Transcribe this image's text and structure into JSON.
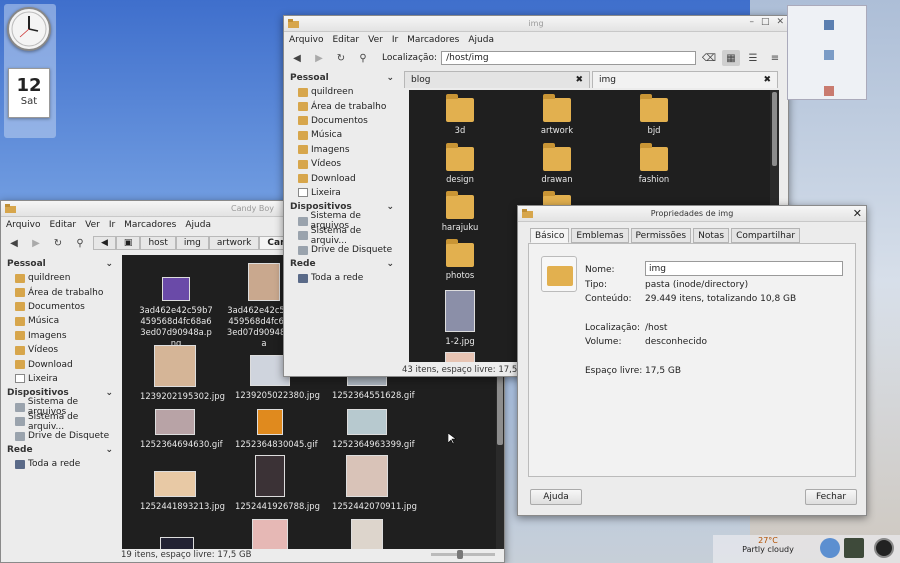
{
  "desktop": {
    "calendar": {
      "day_number": "12",
      "day_name": "Sat"
    }
  },
  "win_img": {
    "title": "img",
    "menu": [
      "Arquivo",
      "Editar",
      "Ver",
      "Ir",
      "Marcadores",
      "Ajuda"
    ],
    "location_label": "Localização:",
    "location_value": "/host/img",
    "sidebar": {
      "pessoal_header": "Pessoal",
      "pessoal": [
        "quildreen",
        "Área de trabalho",
        "Documentos",
        "Música",
        "Imagens",
        "Vídeos",
        "Download",
        "Lixeira"
      ],
      "dispositivos_header": "Dispositivos",
      "dispositivos": [
        "Sistema de arquivos",
        "Sistema de arquiv...",
        "Drive de Disquete"
      ],
      "rede_header": "Rede",
      "rede": [
        "Toda a rede"
      ]
    },
    "tabs": [
      {
        "label": "blog"
      },
      {
        "label": "img"
      }
    ],
    "files": [
      "3d",
      "artwork",
      "bjd",
      "design",
      "drawan",
      "fashion",
      "harajuku",
      "",
      "",
      "photos",
      "1-2.jpg"
    ],
    "status": "43 itens, espaço livre: 17,5 GB"
  },
  "win_candy": {
    "title": "Candy Boy",
    "menu": [
      "Arquivo",
      "Editar",
      "Ver",
      "Ir",
      "Marcadores",
      "Ajuda"
    ],
    "breadcrumb": [
      "host",
      "img",
      "artwork",
      "Cand"
    ],
    "sidebar": {
      "pessoal_header": "Pessoal",
      "pessoal": [
        "quildreen",
        "Área de trabalho",
        "Documentos",
        "Música",
        "Imagens",
        "Vídeos",
        "Download",
        "Lixeira"
      ],
      "dispositivos_header": "Dispositivos",
      "dispositivos": [
        "Sistema de arquivos",
        "Sistema de arquiv...",
        "Drive de Disquete"
      ],
      "rede_header": "Rede",
      "rede": [
        "Toda a rede"
      ]
    },
    "files": [
      "3ad462e42c59b7459568d4fc68a63ed07d90948a.png",
      "3ad462e42c59b7459568d4fc68a63ed07d90948a (La",
      "1239202195302.jpg",
      "1239205022380.jpg",
      "1252364551628.gif",
      "1252364694630.gif",
      "1252364830045.gif",
      "1252364963399.gif",
      "1252441893213.jpg",
      "1252441926788.jpg",
      "1252442070911.jpg"
    ],
    "status": "19 itens, espaço livre: 17,5 GB"
  },
  "props": {
    "title": "Propriedades de img",
    "tabs": [
      "Básico",
      "Emblemas",
      "Permissões",
      "Notas",
      "Compartilhar"
    ],
    "name_label": "Nome:",
    "name_value": "img",
    "type_label": "Tipo:",
    "type_value": "pasta (inode/directory)",
    "content_label": "Conteúdo:",
    "content_value": "29.449 itens, totalizando 10,8 GB",
    "location_label": "Localização:",
    "location_value": "/host",
    "volume_label": "Volume:",
    "volume_value": "desconhecido",
    "free_label": "Espaço livre:",
    "free_value": "17,5 GB",
    "help_button": "Ajuda",
    "close_button": "Fechar"
  },
  "tray": {
    "temperature": "27°C",
    "weather": "Partly cloudy"
  }
}
